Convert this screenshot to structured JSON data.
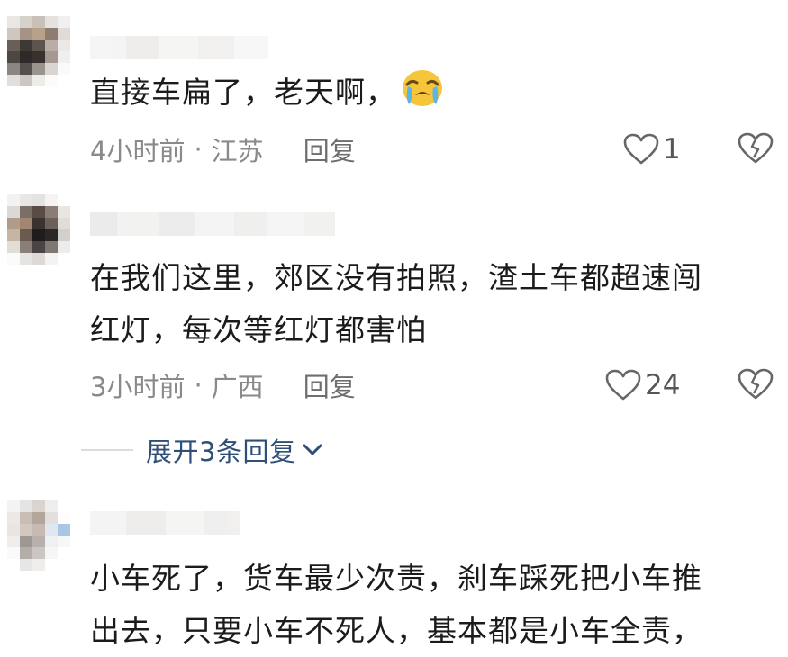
{
  "comments": [
    {
      "text_lines": [
        "直接车扁了，老天啊，"
      ],
      "emoji": "crying-face",
      "time": "4小时前",
      "location": "江苏",
      "reply_label": "回复",
      "likes": "1"
    },
    {
      "text_lines": [
        "在我们这里，郊区没有拍照，渣土车都超速闯",
        "红灯，每次等红灯都害怕"
      ],
      "time": "3小时前",
      "location": "广西",
      "reply_label": "回复",
      "likes": "24"
    },
    {
      "text_lines": [
        "小车死了，货车最少次责，刹车踩死把小车推",
        "出去，只要小车不死人，基本都是小车全责，"
      ]
    }
  ],
  "expand_replies": "展开3条回复",
  "separator": "·",
  "colors": {
    "text": "#1b1b1b",
    "meta": "#8a8a8a",
    "link": "#2f4f79"
  }
}
